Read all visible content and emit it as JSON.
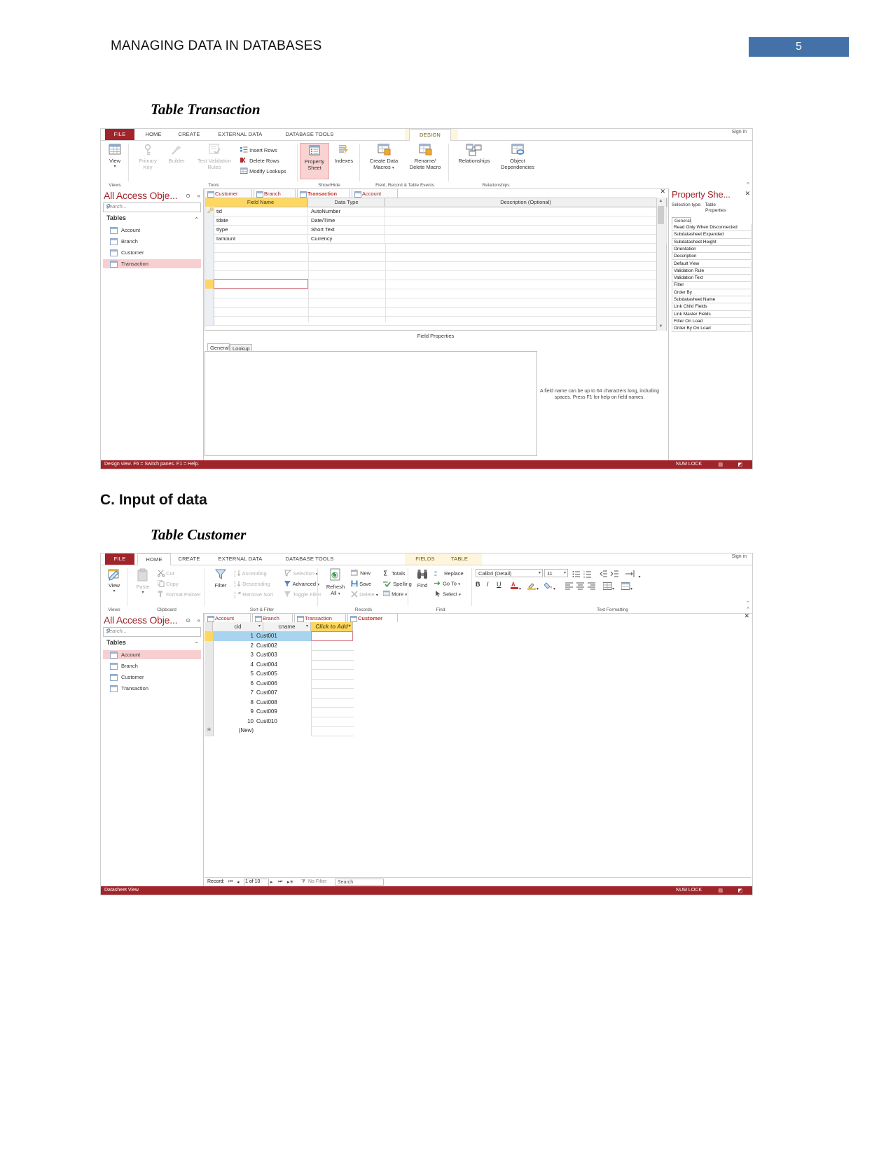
{
  "document": {
    "header_title": "MANAGING DATA IN DATABASES",
    "page_number": "5",
    "accent_color": "#4472a8",
    "caption_transaction": "Table Transaction",
    "section_c": "C. Input of data",
    "caption_customer": "Table Customer"
  },
  "design_window": {
    "ribbon_tabs": [
      {
        "label": "FILE"
      },
      {
        "label": "HOME"
      },
      {
        "label": "CREATE"
      },
      {
        "label": "EXTERNAL DATA"
      },
      {
        "label": "DATABASE TOOLS"
      },
      {
        "label": "DESIGN"
      }
    ],
    "sign_in": "Sign in",
    "groups": [
      {
        "label": "Views"
      },
      {
        "label": "Tools"
      },
      {
        "label": "Show/Hide"
      },
      {
        "label": "Field, Record & Table Events"
      },
      {
        "label": "Relationships"
      }
    ],
    "buttons": {
      "view": "View",
      "primary_key": "Primary\nKey",
      "primary_key_l1": "Primary",
      "primary_key_l2": "Key",
      "builder": "Builder",
      "test_validation_l1": "Test Validation",
      "test_validation_l2": "Rules",
      "insert_rows": "Insert Rows",
      "delete_rows": "Delete Rows",
      "modify_lookups": "Modify Lookups",
      "property_sheet_l1": "Property",
      "property_sheet_l2": "Sheet",
      "indexes": "Indexes",
      "create_data_macros_l1": "Create Data",
      "create_data_macros_l2": "Macros",
      "rename_delete_macro_l1": "Rename/",
      "rename_delete_macro_l2": "Delete Macro",
      "relationships": "Relationships",
      "object_dependencies_l1": "Object",
      "object_dependencies_l2": "Dependencies"
    },
    "nav_pane": {
      "title": "All Access Obje...",
      "search_placeholder": "Search...",
      "group_label": "Tables",
      "items": [
        {
          "label": "Account",
          "selected": false
        },
        {
          "label": "Branch",
          "selected": false
        },
        {
          "label": "Customer",
          "selected": false
        },
        {
          "label": "Transaction",
          "selected": true
        }
      ]
    },
    "doc_tabs": [
      {
        "label": "Customer",
        "active": false
      },
      {
        "label": "Branch",
        "active": false
      },
      {
        "label": "Transaction",
        "active": true
      },
      {
        "label": "Account",
        "active": false
      }
    ],
    "grid": {
      "columns": [
        "Field Name",
        "Data Type",
        "Description (Optional)"
      ],
      "rows": [
        {
          "field": "tid",
          "type": "AutoNumber",
          "desc": "",
          "pk": true
        },
        {
          "field": "tdate",
          "type": "Date/Time",
          "desc": "",
          "pk": false
        },
        {
          "field": "ttype",
          "type": "Short Text",
          "desc": "",
          "pk": false
        },
        {
          "field": "tamount",
          "type": "Currency",
          "desc": "",
          "pk": false
        }
      ]
    },
    "field_properties_label": "Field Properties",
    "property_tabs": [
      {
        "label": "General",
        "active": true
      },
      {
        "label": "Lookup",
        "active": false
      }
    ],
    "help_text": "A field name can be up to 64 characters long, including spaces. Press F1 for help on field names.",
    "property_sheet": {
      "title": "Property She...",
      "selection_type_label": "Selection type:",
      "selection_type_value": "Table",
      "selection_type_value2": "Properties",
      "tab": "General",
      "rows": [
        "Read Only When Disconnected",
        "Subdatasheet Expanded",
        "Subdatasheet Height",
        "Orientation",
        "Description",
        "Default View",
        "Validation Rule",
        "Validation Text",
        "Filter",
        "Order By",
        "Subdatasheet Name",
        "Link Child Fields",
        "Link Master Fields",
        "Filter On Load",
        "Order By On Load"
      ]
    },
    "status": {
      "left": "Design view.  F6 = Switch panes.  F1 = Help.",
      "numlock": "NUM LOCK"
    }
  },
  "datasheet_window": {
    "ribbon_tabs": [
      {
        "label": "FILE"
      },
      {
        "label": "HOME"
      },
      {
        "label": "CREATE"
      },
      {
        "label": "EXTERNAL DATA"
      },
      {
        "label": "DATABASE TOOLS"
      },
      {
        "label": "FIELDS"
      },
      {
        "label": "TABLE"
      }
    ],
    "sign_in": "Sign in",
    "groups": [
      {
        "label": "Views"
      },
      {
        "label": "Clipboard"
      },
      {
        "label": "Sort & Filter"
      },
      {
        "label": "Records"
      },
      {
        "label": "Find"
      },
      {
        "label": "Text Formatting"
      }
    ],
    "buttons": {
      "view": "View",
      "paste": "Paste",
      "cut": "Cut",
      "copy": "Copy",
      "format_painter": "Format Painter",
      "filter": "Filter",
      "ascending": "Ascending",
      "descending": "Descending",
      "remove_sort": "Remove Sort",
      "selection": "Selection",
      "advanced": "Advanced",
      "toggle_filter": "Toggle Filter",
      "refresh_all_l1": "Refresh",
      "refresh_all_l2": "All",
      "new": "New",
      "save": "Save",
      "delete": "Delete",
      "totals": "Totals",
      "spelling": "Spelling",
      "more": "More",
      "find": "Find",
      "replace": "Replace",
      "go_to": "Go To",
      "select": "Select"
    },
    "formatting": {
      "font_name": "Calibri (Detail)",
      "font_size": "11"
    },
    "nav_pane": {
      "title": "All Access Obje...",
      "search_placeholder": "Search...",
      "group_label": "Tables",
      "items": [
        {
          "label": "Account",
          "selected": true
        },
        {
          "label": "Branch",
          "selected": false
        },
        {
          "label": "Customer",
          "selected": false
        },
        {
          "label": "Transaction",
          "selected": false
        }
      ]
    },
    "doc_tabs": [
      {
        "label": "Account",
        "active": false
      },
      {
        "label": "Branch",
        "active": false
      },
      {
        "label": "Transaction",
        "active": false
      },
      {
        "label": "Customer",
        "active": true
      }
    ],
    "table": {
      "columns": [
        "cid",
        "cname",
        "Click to Add"
      ],
      "rows": [
        {
          "cid": "1",
          "cname": "Cust001"
        },
        {
          "cid": "2",
          "cname": "Cust002"
        },
        {
          "cid": "3",
          "cname": "Cust003"
        },
        {
          "cid": "4",
          "cname": "Cust004"
        },
        {
          "cid": "5",
          "cname": "Cust005"
        },
        {
          "cid": "6",
          "cname": "Cust006"
        },
        {
          "cid": "7",
          "cname": "Cust007"
        },
        {
          "cid": "8",
          "cname": "Cust008"
        },
        {
          "cid": "9",
          "cname": "Cust009"
        },
        {
          "cid": "10",
          "cname": "Cust010"
        }
      ],
      "new_row_label": "(New)"
    },
    "record_nav": {
      "label": "Record:",
      "position": "1 of 10",
      "filter_label": "No Filter",
      "search_placeholder": "Search"
    },
    "status": {
      "left": "Datasheet View",
      "numlock": "NUM LOCK"
    }
  }
}
